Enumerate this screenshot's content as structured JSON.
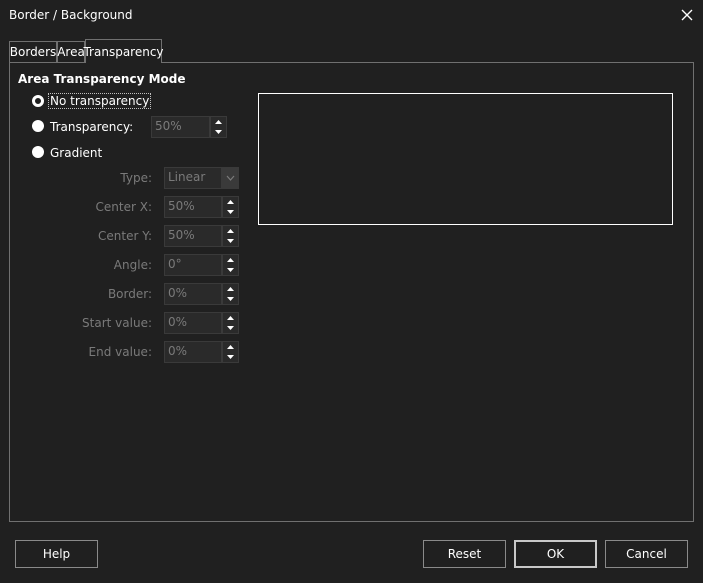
{
  "window": {
    "title": "Border / Background"
  },
  "tabs": [
    {
      "label": "Borders"
    },
    {
      "label": "Area"
    },
    {
      "label": "Transparency"
    }
  ],
  "mode": {
    "title": "Area Transparency Mode",
    "no_transparency": "No transparency",
    "transparency": "Transparency:",
    "transparency_value": "50%",
    "gradient": "Gradient",
    "selected": "no_transparency"
  },
  "gradient": {
    "type_label": "Type:",
    "type_value": "Linear",
    "center_x_label": "Center X:",
    "center_x_value": "50%",
    "center_y_label": "Center Y:",
    "center_y_value": "50%",
    "angle_label": "Angle:",
    "angle_value": "0°",
    "border_label": "Border:",
    "border_value": "0%",
    "start_label": "Start value:",
    "start_value": "0%",
    "end_label": "End value:",
    "end_value": "0%"
  },
  "buttons": {
    "help": "Help",
    "reset": "Reset",
    "ok": "OK",
    "cancel": "Cancel"
  },
  "colors": {
    "background": "#202020",
    "text": "#ffffff",
    "disabled_text": "#7a7a7a",
    "border": "#707070"
  }
}
